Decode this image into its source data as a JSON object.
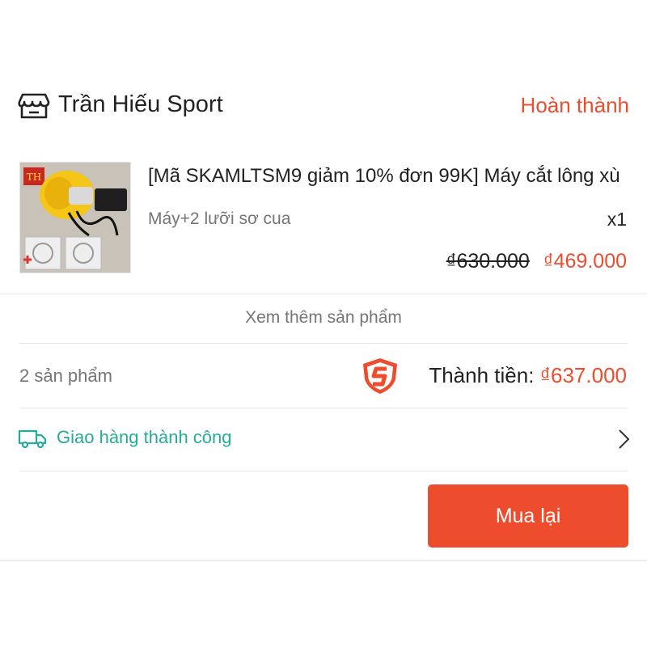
{
  "shop": {
    "icon": "shop-icon",
    "name": "Trần Hiếu Sport",
    "status": "Hoàn thành"
  },
  "product": {
    "image": "product-thumbnail",
    "title": "[Mã SKAMLTSM9 giảm 10% đơn 99K] Máy cắt lông xù",
    "variant": "Máy+2 lưỡi sơ cua",
    "quantity": "x1",
    "price_original": "₫630.000",
    "price_sale": "₫469.000"
  },
  "view_more": "Xem thêm sản phẩm",
  "summary": {
    "item_count": "2 sản phẩm",
    "guarantee_icon": "shopee-guarantee-icon",
    "total_label": "Thành tiền:",
    "total_value": "₫637.000"
  },
  "delivery": {
    "icon": "truck-icon",
    "text": "Giao hàng thành công"
  },
  "actions": {
    "rebuy_label": "Mua lại"
  },
  "colors": {
    "accent": "#ee4d2d",
    "success": "#26aa99",
    "muted": "#757575"
  }
}
